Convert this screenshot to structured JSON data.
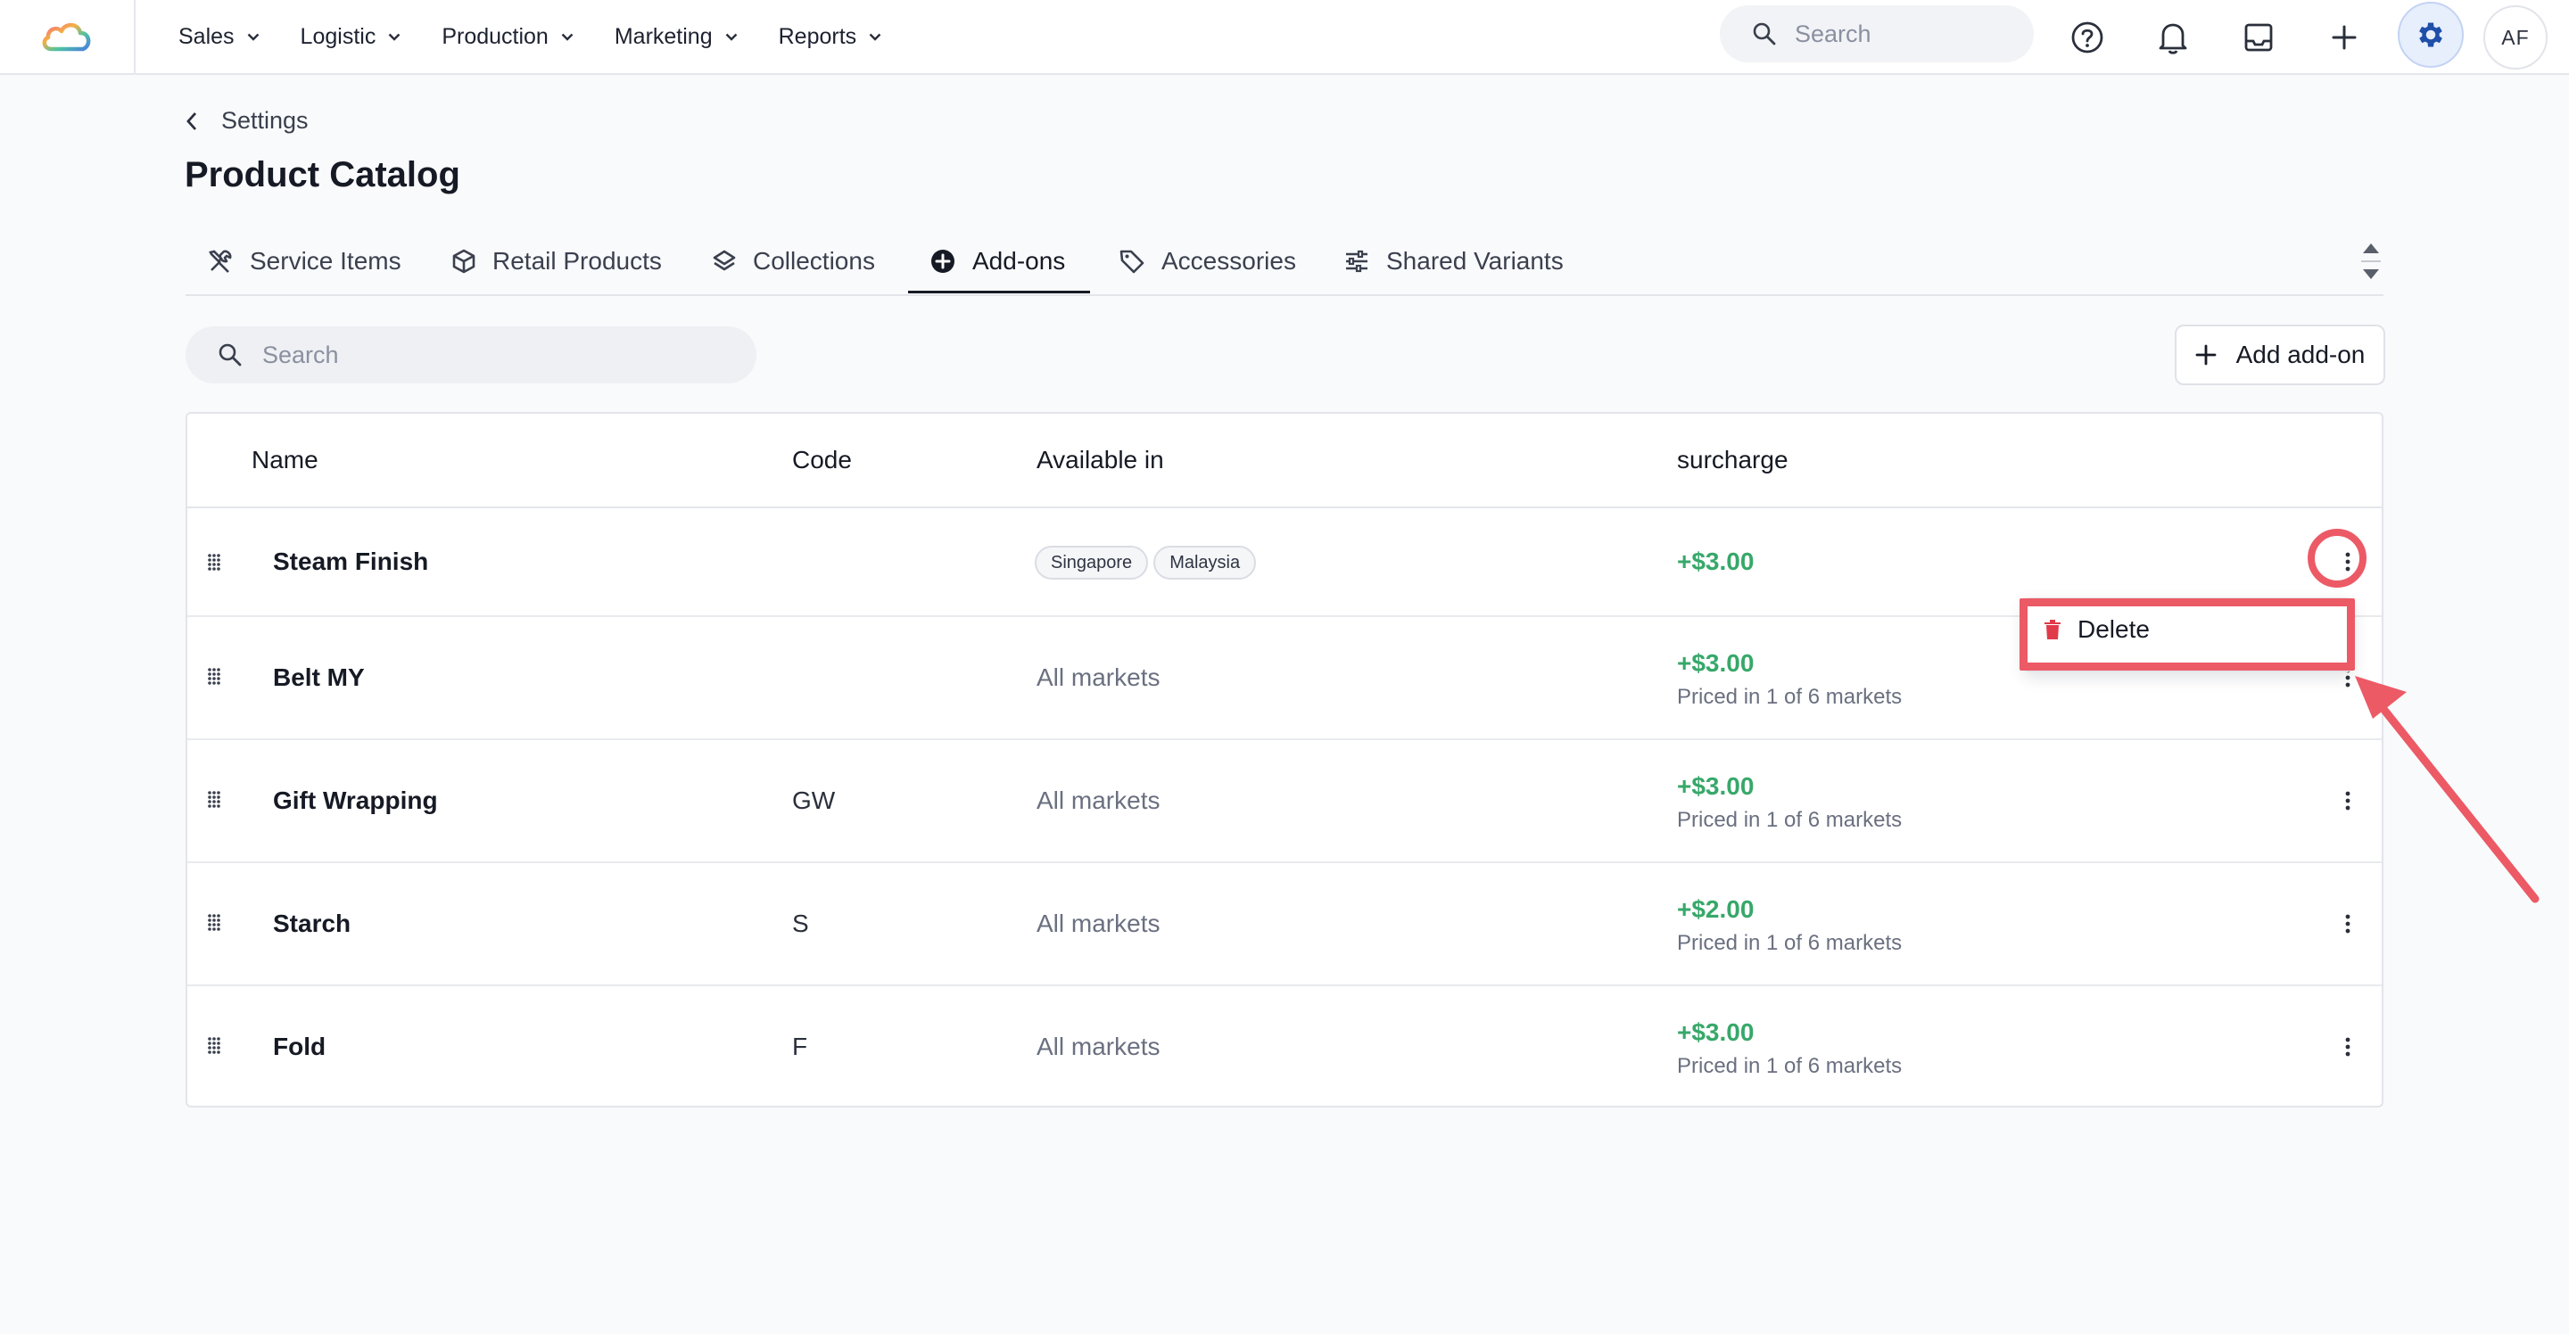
{
  "nav": {
    "items": [
      {
        "label": "Sales"
      },
      {
        "label": "Logistic"
      },
      {
        "label": "Production"
      },
      {
        "label": "Marketing"
      },
      {
        "label": "Reports"
      }
    ],
    "search_placeholder": "Search",
    "avatar_initials": "AF"
  },
  "page": {
    "breadcrumb": "Settings",
    "title": "Product Catalog"
  },
  "tabs": [
    {
      "label": "Service Items",
      "icon": "tools-icon"
    },
    {
      "label": "Retail Products",
      "icon": "box-icon"
    },
    {
      "label": "Collections",
      "icon": "layers-icon"
    },
    {
      "label": "Add-ons",
      "icon": "plus-circle-icon",
      "active": true
    },
    {
      "label": "Accessories",
      "icon": "tag-icon"
    },
    {
      "label": "Shared Variants",
      "icon": "sliders-icon"
    }
  ],
  "toolbar": {
    "search_placeholder": "Search",
    "add_label": "Add add-on"
  },
  "table": {
    "columns": [
      "Name",
      "Code",
      "Available in",
      "surcharge"
    ],
    "rows": [
      {
        "name": "Steam Finish",
        "code": "",
        "available": [
          "Singapore",
          "Malaysia"
        ],
        "price": "+$3.00",
        "priced_in": ""
      },
      {
        "name": "Belt MY",
        "code": "",
        "available": "All markets",
        "price": "+$3.00",
        "priced_in": "Priced in 1 of 6 markets"
      },
      {
        "name": "Gift Wrapping",
        "code": "GW",
        "available": "All markets",
        "price": "+$3.00",
        "priced_in": "Priced in 1 of 6 markets"
      },
      {
        "name": "Starch",
        "code": "S",
        "available": "All markets",
        "price": "+$2.00",
        "priced_in": "Priced in 1 of 6 markets"
      },
      {
        "name": "Fold",
        "code": "F",
        "available": "All markets",
        "price": "+$3.00",
        "priced_in": "Priced in 1 of 6 markets"
      }
    ]
  },
  "row_menu": {
    "delete_label": "Delete"
  },
  "colors": {
    "accent": "#1f5fd0",
    "price_green": "#37a86a",
    "annotation_red": "#ec5a66",
    "delete_red": "#e0394a"
  }
}
